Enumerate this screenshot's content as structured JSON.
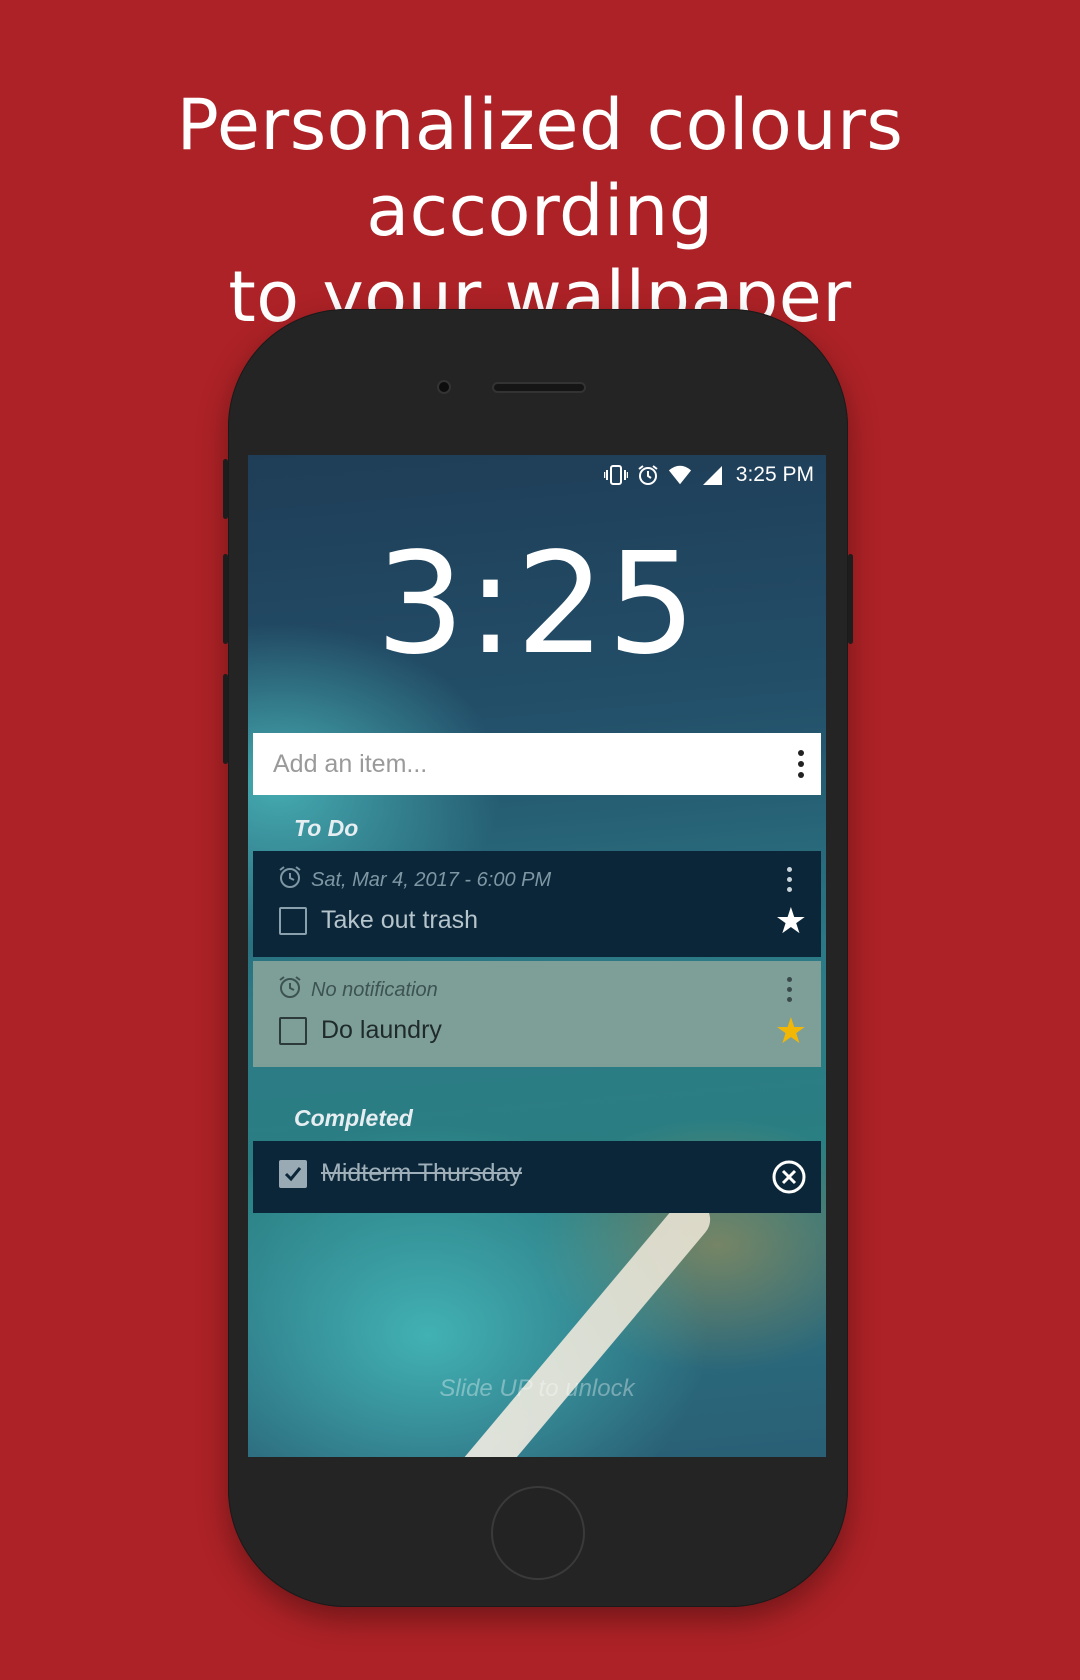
{
  "headline": {
    "line1": "Personalized colours according",
    "line2": "to your wallpaper"
  },
  "status_bar": {
    "icons": [
      "vibrate-icon",
      "alarm-icon",
      "wifi-icon",
      "signal-icon"
    ],
    "time": "3:25 PM"
  },
  "lock_clock": "3:25",
  "add_item": {
    "placeholder": "Add an item..."
  },
  "sections": {
    "todo_label": "To Do",
    "completed_label": "Completed"
  },
  "todo_items": [
    {
      "reminder": "Sat, Mar 4, 2017 - 6:00 PM",
      "title": "Take out trash",
      "star_color": "#ffffff",
      "card_color": "#0b2638"
    },
    {
      "reminder": "No notification",
      "title": "Do laundry",
      "star_color": "#f2b705",
      "card_color": "#7e9f98"
    }
  ],
  "completed_items": [
    {
      "title": "Midterm Thursday"
    }
  ],
  "unlock_hint": "Slide UP to unlock",
  "colors": {
    "background": "#ad2226",
    "phone_body": "#242424",
    "dark_card": "#0b2638",
    "light_card": "#7e9f98",
    "star_gold": "#f2b705"
  }
}
